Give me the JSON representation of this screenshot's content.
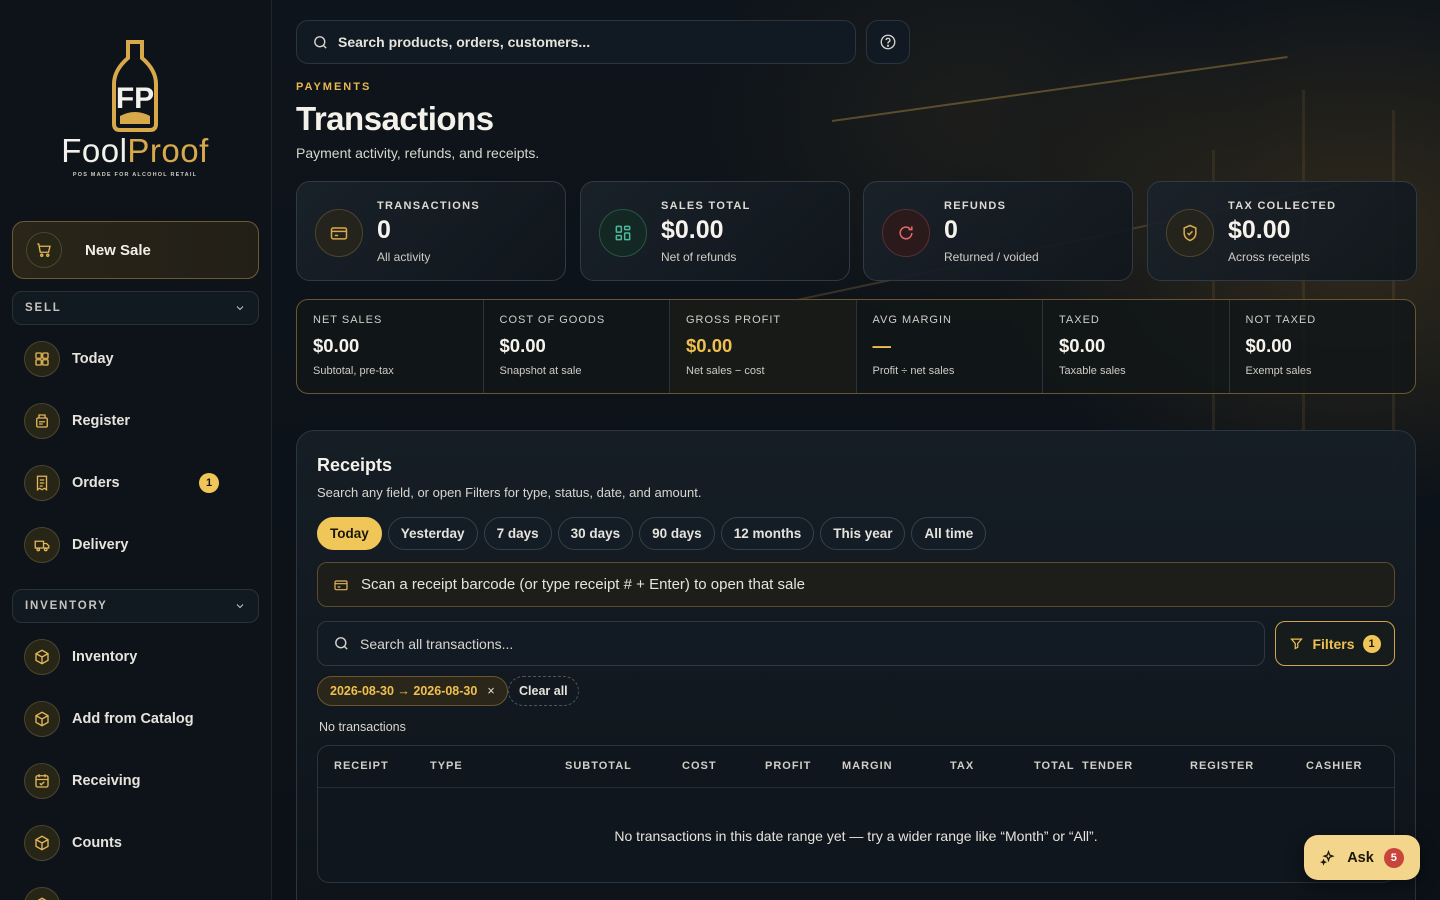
{
  "brand": {
    "name_part1": "Fool",
    "name_part2": "Proof",
    "tagline": "POS MADE FOR ALCOHOL RETAIL",
    "accent": "#f0c04e"
  },
  "sidebar": {
    "new_sale": "New Sale",
    "sections": [
      {
        "label": "SELL",
        "items": [
          {
            "label": "Today",
            "icon": "dashboard-icon"
          },
          {
            "label": "Register",
            "icon": "register-icon"
          },
          {
            "label": "Orders",
            "icon": "receipt-icon",
            "badge": "1"
          },
          {
            "label": "Delivery",
            "icon": "truck-icon"
          }
        ]
      },
      {
        "label": "INVENTORY",
        "items": [
          {
            "label": "Inventory",
            "icon": "box-icon"
          },
          {
            "label": "Add from Catalog",
            "icon": "box-icon"
          },
          {
            "label": "Receiving",
            "icon": "calendar-check-icon"
          },
          {
            "label": "Counts",
            "icon": "box-icon"
          }
        ]
      }
    ]
  },
  "header": {
    "search_placeholder": "Search products, orders, customers..."
  },
  "page": {
    "eyebrow": "PAYMENTS",
    "title": "Transactions",
    "subtitle": "Payment activity, refunds, and receipts."
  },
  "stats": [
    {
      "label": "TRANSACTIONS",
      "value": "0",
      "sub": "All activity",
      "icon": "card-icon",
      "color": "#d7a94a"
    },
    {
      "label": "SALES TOTAL",
      "value": "$0.00",
      "sub": "Net of refunds",
      "icon": "grid-icon",
      "color": "#4fb89a"
    },
    {
      "label": "REFUNDS",
      "value": "0",
      "sub": "Returned / voided",
      "icon": "refund-icon",
      "color": "#e06a6a"
    },
    {
      "label": "TAX COLLECTED",
      "value": "$0.00",
      "sub": "Across receipts",
      "icon": "shield-check-icon",
      "color": "#d7a94a"
    }
  ],
  "metrics": [
    {
      "label": "NET SALES",
      "value": "$0.00",
      "sub": "Subtotal, pre-tax"
    },
    {
      "label": "COST OF GOODS",
      "value": "$0.00",
      "sub": "Snapshot at sale"
    },
    {
      "label": "GROSS PROFIT",
      "value": "$0.00",
      "sub": "Net sales − cost"
    },
    {
      "label": "AVG MARGIN",
      "value": "—",
      "sub": "Profit ÷ net sales"
    },
    {
      "label": "TAXED",
      "value": "$0.00",
      "sub": "Taxable sales"
    },
    {
      "label": "NOT TAXED",
      "value": "$0.00",
      "sub": "Exempt sales"
    }
  ],
  "receipts": {
    "title": "Receipts",
    "subtitle": "Search any field, or open Filters for type, status, date, and amount.",
    "ranges": [
      "Today",
      "Yesterday",
      "7 days",
      "30 days",
      "90 days",
      "12 months",
      "This year",
      "All time"
    ],
    "active_range": "Today",
    "scan_placeholder": "Scan a receipt barcode (or type receipt # + Enter) to open that sale",
    "search_placeholder": "Search all transactions...",
    "filters_label": "Filters",
    "filters_count": "1",
    "date_chip": "2026-08-30 → 2026-08-30",
    "date_chip_remove": "×",
    "clear_all": "Clear all",
    "count_text": "No transactions",
    "columns": [
      "RECEIPT",
      "TYPE",
      "SUBTOTAL",
      "COST",
      "PROFIT",
      "MARGIN",
      "TAX",
      "TOTAL",
      "TENDER",
      "REGISTER",
      "CASHIER"
    ],
    "empty_message": "No transactions in this date range yet — try a wider range like “Month” or “All”."
  },
  "ask": {
    "label": "Ask",
    "badge": "5"
  }
}
